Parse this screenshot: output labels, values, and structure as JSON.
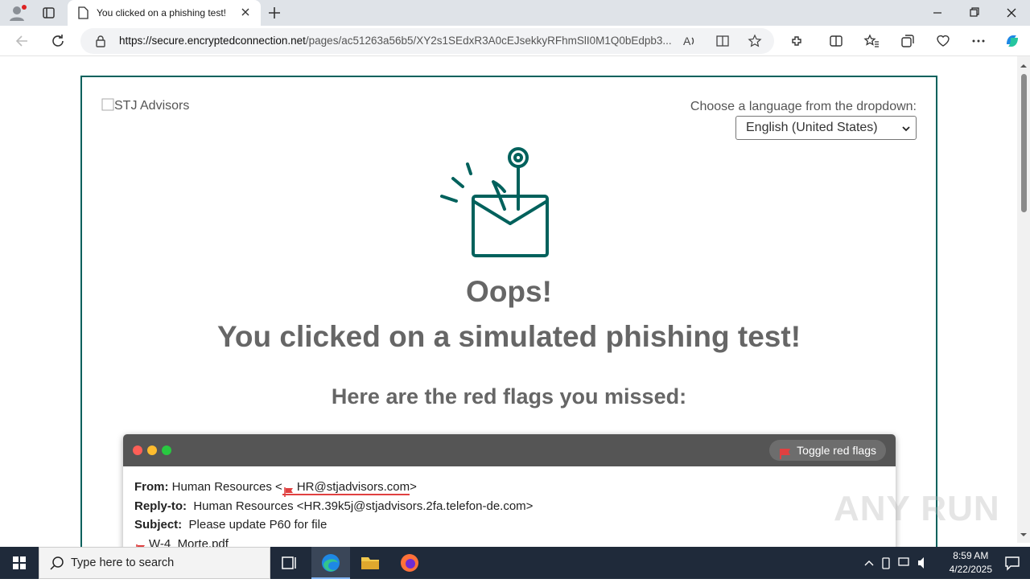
{
  "browser": {
    "tab_title": "You clicked on a phishing test!",
    "url_domain": "https://secure.encryptedconnection.net",
    "url_path": "/pages/ac51263a56b5/XY2s1SEdxR3A0cEJsekkyRFhmSlI0M1Q0bEdpb3..."
  },
  "page": {
    "logo_alt": "STJ Advisors",
    "language_label": "Choose a language from the dropdown:",
    "language_selected": "English (United States)",
    "oops": "Oops!",
    "headline": "You clicked on a simulated phishing test!",
    "red_flags_heading": "Here are the red flags you missed:",
    "toggle_label": "Toggle red flags",
    "email": {
      "from_label": "From:",
      "from_name": "Human Resources <",
      "from_address": "HR@stjadvisors.com",
      "from_close": ">",
      "replyto_label": "Reply-to:",
      "replyto_value": "Human Resources <HR.39k5j@stjadvisors.2fa.telefon-de.com>",
      "subject_label": "Subject:",
      "subject_value": "Please update P60 for file",
      "attachment": "W-4_Morte.pdf"
    },
    "watermark": "ANY RUN"
  },
  "taskbar": {
    "search_placeholder": "Type here to search",
    "time": "8:59 AM",
    "date": "4/22/2025"
  },
  "colors": {
    "accent": "#00615c",
    "flag": "#e04040"
  }
}
